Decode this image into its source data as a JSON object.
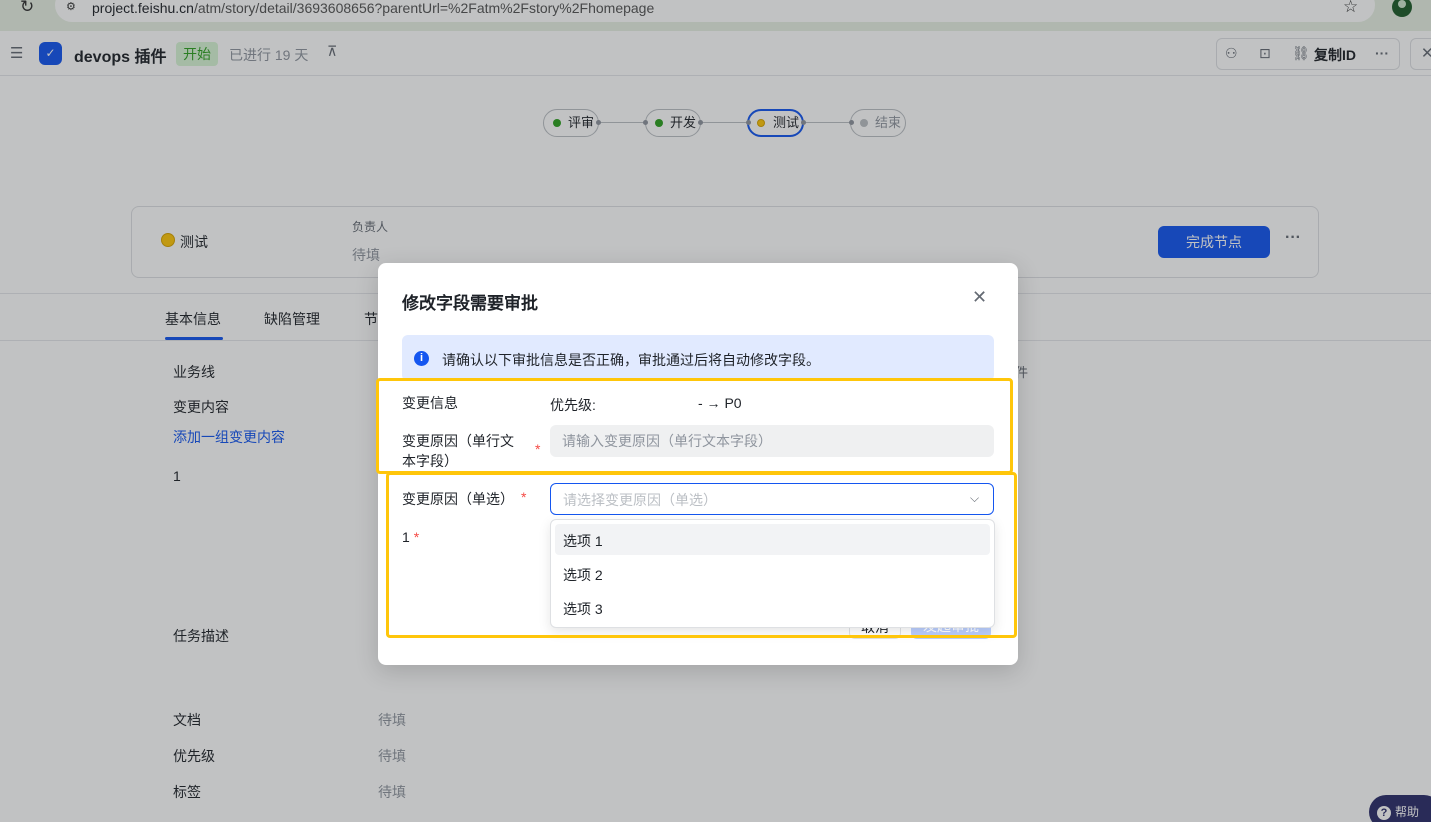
{
  "browser": {
    "url_host": "project.feishu.cn",
    "url_path": "/atm/story/detail/3693608656?parentUrl=%2Fatm%2Fstory%2Fhomepage"
  },
  "header": {
    "title": "devops 插件",
    "status": "开始",
    "elapsed": "已进行 19 天",
    "copy_id": "复制ID"
  },
  "workflow": {
    "nodes": [
      {
        "label": "评审",
        "state": "done",
        "color": "#2ea121"
      },
      {
        "label": "开发",
        "state": "done",
        "color": "#2ea121"
      },
      {
        "label": "测试",
        "state": "active",
        "color": "#ffc60a"
      },
      {
        "label": "结束",
        "state": "pending",
        "color": "#bbbfc4"
      }
    ]
  },
  "node_card": {
    "name": "测试",
    "owner_label": "负责人",
    "owner_value": "待填",
    "complete_button": "完成节点",
    "more": "···"
  },
  "tabs": [
    "基本信息",
    "缺陷管理",
    "节"
  ],
  "fields": {
    "business_line": "业务线",
    "change_content": "变更内容",
    "add_change": "添加一组变更内容",
    "row_number": "1",
    "task_desc": "任务描述",
    "doc": "文档",
    "doc_value": "待填",
    "priority": "优先级",
    "priority_value": "待填",
    "tags": "标签",
    "tags_value": "待填",
    "side_char": "件"
  },
  "help": "帮助",
  "modal": {
    "title": "修改字段需要审批",
    "banner": "请确认以下审批信息是否正确，审批通过后将自动修改字段。",
    "change_info_label": "变更信息",
    "change_key": "优先级:",
    "change_value": "- → P0",
    "reason_text_label": "变更原因（单行文本字段）",
    "reason_text_placeholder": "请输入变更原因（单行文本字段）",
    "reason_select_label": "变更原因（单选）",
    "reason_select_placeholder": "请选择变更原因（单选）",
    "extra_label": "1",
    "options": [
      "选项 1",
      "选项 2",
      "选项 3"
    ],
    "cancel": "取消",
    "submit": "发起审批"
  },
  "colors": {
    "accent": "#1456f0",
    "highlight": "#ffc60a",
    "required": "#f54a45"
  }
}
